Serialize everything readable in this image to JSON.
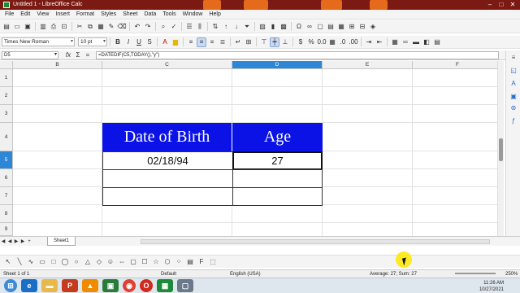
{
  "window": {
    "title": "Untitled 1 - LibreOffice Calc"
  },
  "menu": [
    "File",
    "Edit",
    "View",
    "Insert",
    "Format",
    "Styles",
    "Sheet",
    "Data",
    "Tools",
    "Window",
    "Help"
  ],
  "toolbar2": {
    "font_name": "Times New Roman",
    "font_size": "10 pt"
  },
  "formula_bar": {
    "name_box": "D5",
    "formula": "=DATEDIF(C5,TODAY(),\"y\")"
  },
  "columns": [
    "B",
    "C",
    "D",
    "E",
    "F"
  ],
  "selected_column": "D",
  "rows": [
    "1",
    "2",
    "3",
    "4",
    "5",
    "6",
    "7",
    "8",
    "9"
  ],
  "selected_row": "5",
  "table": {
    "header": {
      "col1": "Date of Birth",
      "col2": "Age"
    },
    "row5": {
      "c": "02/18/94",
      "d": "27"
    }
  },
  "sheet_tabs": [
    "Sheet1"
  ],
  "status": {
    "sheet": "Sheet 1 of 1",
    "style": "Default",
    "language": "English (USA)",
    "summary": "Average: 27; Sum: 27",
    "zoom": "250%"
  },
  "clock": {
    "time": "11:26 AM",
    "date": "10/27/2021"
  },
  "colors": {
    "header_bg": "#0a12e6",
    "selection": "#2e86d6"
  }
}
